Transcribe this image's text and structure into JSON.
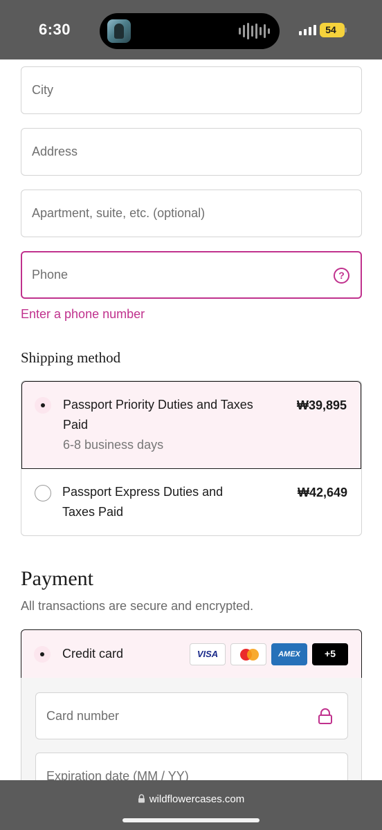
{
  "status_bar": {
    "time": "6:30",
    "battery": "54"
  },
  "form": {
    "city_placeholder": "City",
    "address_placeholder": "Address",
    "apartment_placeholder": "Apartment, suite, etc. (optional)",
    "phone_placeholder": "Phone",
    "phone_help_icon": "?",
    "phone_error": "Enter a phone number"
  },
  "shipping": {
    "title": "Shipping method",
    "options": [
      {
        "name": "Passport Priority Duties and Taxes Paid",
        "sub": "6-8 business days",
        "price": "₩39,895",
        "selected": true
      },
      {
        "name": "Passport Express Duties and Taxes Paid",
        "sub": "",
        "price": "₩42,649",
        "selected": false
      }
    ]
  },
  "payment": {
    "title": "Payment",
    "subtitle": "All transactions are secure and encrypted.",
    "method_label": "Credit card",
    "badges": {
      "visa": "VISA",
      "amex": "AMEX",
      "more": "+5"
    },
    "card_number_placeholder": "Card number",
    "expiration_placeholder": "Expiration date (MM / YY)"
  },
  "browser": {
    "url": "wildflowercases.com"
  },
  "colors": {
    "accent": "#c0318d",
    "selected_bg": "#fdf1f5",
    "chrome": "#5b5b5b"
  }
}
